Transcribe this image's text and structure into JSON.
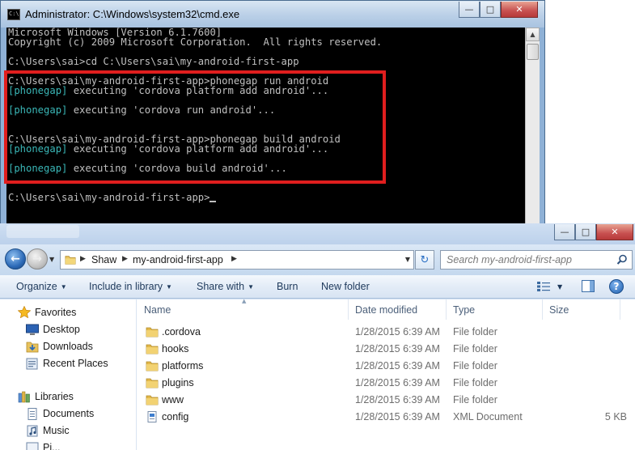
{
  "cmd": {
    "title": "Administrator: C:\\Windows\\system32\\cmd.exe",
    "lines": [
      {
        "text": "Microsoft Windows [Version 6.1.7600]"
      },
      {
        "text": "Copyright (c) 2009 Microsoft Corporation.  All rights reserved."
      },
      {
        "text": ""
      },
      {
        "text": "C:\\Users\\sai>cd C:\\Users\\sai\\my-android-first-app"
      },
      {
        "text": ""
      },
      {
        "text": "C:\\Users\\sai\\my-android-first-app>phonegap run android"
      },
      {
        "tag": "[phonegap]",
        "text": " executing 'cordova platform add android'..."
      },
      {
        "text": ""
      },
      {
        "tag": "[phonegap]",
        "text": " executing 'cordova run android'..."
      },
      {
        "text": ""
      },
      {
        "text": ""
      },
      {
        "text": "C:\\Users\\sai\\my-android-first-app>phonegap build android"
      },
      {
        "tag": "[phonegap]",
        "text": " executing 'cordova platform add android'..."
      },
      {
        "text": ""
      },
      {
        "tag": "[phonegap]",
        "text": " executing 'cordova build android'..."
      },
      {
        "text": ""
      },
      {
        "text": ""
      },
      {
        "text": "C:\\Users\\sai\\my-android-first-app>",
        "cursor": true
      }
    ],
    "highlight_color": "#e01e1e"
  },
  "explorer": {
    "breadcrumb": [
      "Shaw",
      "my-android-first-app"
    ],
    "search_placeholder": "Search my-android-first-app",
    "toolbar": {
      "organize": "Organize",
      "include_in_library": "Include in library",
      "share_with": "Share with",
      "burn": "Burn",
      "new_folder": "New folder"
    },
    "nav": {
      "favorites": "Favorites",
      "desktop": "Desktop",
      "downloads": "Downloads",
      "recent_places": "Recent Places",
      "libraries": "Libraries",
      "documents": "Documents",
      "music": "Music",
      "pictures": "Pi..."
    },
    "columns": {
      "name": "Name",
      "date_modified": "Date modified",
      "type": "Type",
      "size": "Size"
    },
    "files": [
      {
        "name": ".cordova",
        "date": "1/28/2015 6:39 AM",
        "type": "File folder",
        "size": "",
        "icon": "folder-icon"
      },
      {
        "name": "hooks",
        "date": "1/28/2015 6:39 AM",
        "type": "File folder",
        "size": "",
        "icon": "folder-icon"
      },
      {
        "name": "platforms",
        "date": "1/28/2015 6:39 AM",
        "type": "File folder",
        "size": "",
        "icon": "folder-icon"
      },
      {
        "name": "plugins",
        "date": "1/28/2015 6:39 AM",
        "type": "File folder",
        "size": "",
        "icon": "folder-icon"
      },
      {
        "name": "www",
        "date": "1/28/2015 6:39 AM",
        "type": "File folder",
        "size": "",
        "icon": "folder-icon"
      },
      {
        "name": "config",
        "date": "1/28/2015 6:39 AM",
        "type": "XML Document",
        "size": "5 KB",
        "icon": "xml-document-icon"
      }
    ]
  }
}
